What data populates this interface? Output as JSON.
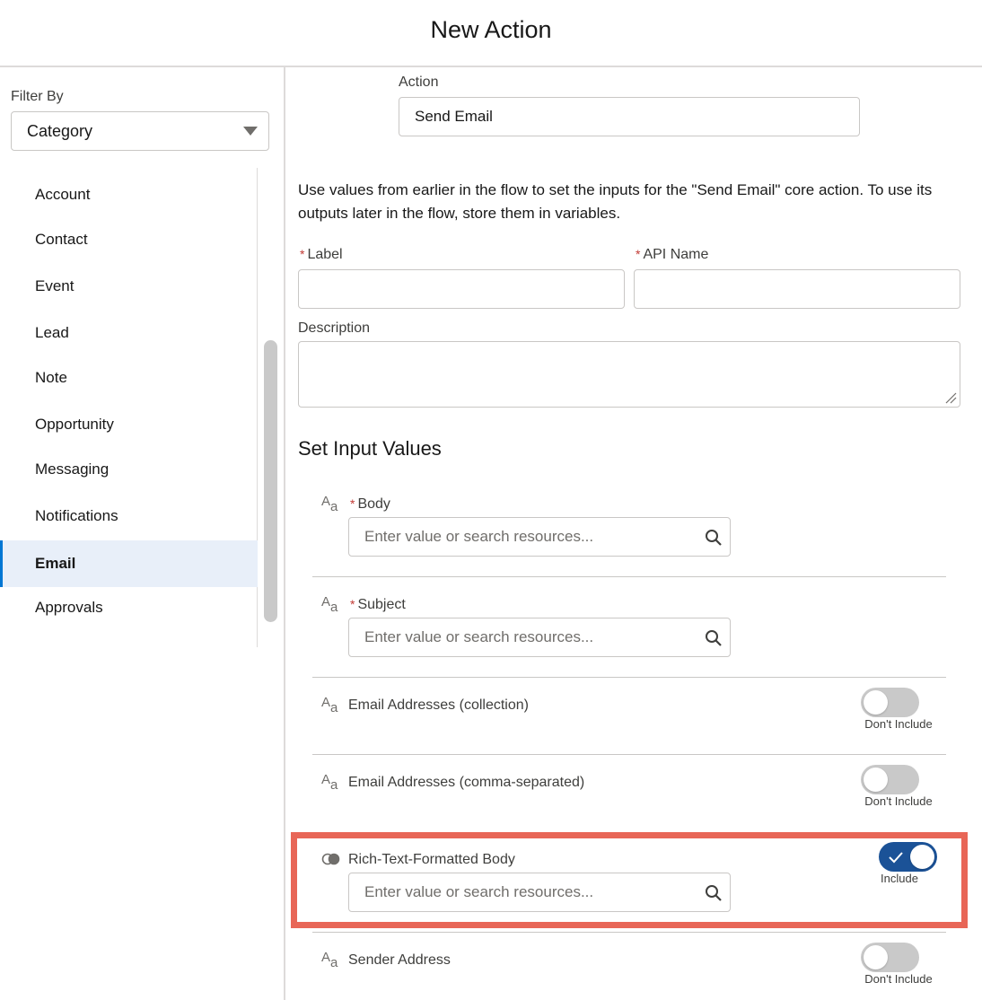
{
  "header": {
    "title": "New Action"
  },
  "sidebar": {
    "filter_label": "Filter By",
    "filter_value": "Category",
    "items": [
      {
        "label": "Account",
        "active": false
      },
      {
        "label": "Contact",
        "active": false
      },
      {
        "label": "Event",
        "active": false
      },
      {
        "label": "Lead",
        "active": false
      },
      {
        "label": "Note",
        "active": false
      },
      {
        "label": "Opportunity",
        "active": false
      },
      {
        "label": "Messaging",
        "active": false
      },
      {
        "label": "Notifications",
        "active": false
      },
      {
        "label": "Email",
        "active": true
      },
      {
        "label": "Approvals",
        "active": false
      }
    ]
  },
  "main": {
    "action_label": "Action",
    "action_value": "Send Email",
    "description_text": "Use values from earlier in the flow to set the inputs for the \"Send Email\" core action. To use its outputs later in the flow, store them in variables.",
    "label_field": {
      "label": "Label",
      "required_marker": "*",
      "value": ""
    },
    "api_name_field": {
      "label": "API Name",
      "required_marker": "*",
      "value": ""
    },
    "description_field": {
      "label": "Description",
      "value": ""
    },
    "section_title": "Set Input Values",
    "inputs": {
      "body": {
        "label": "Body",
        "required_marker": "*",
        "placeholder": "Enter value or search resources...",
        "type_icon": "text-type-icon"
      },
      "subject": {
        "label": "Subject",
        "required_marker": "*",
        "placeholder": "Enter value or search resources...",
        "type_icon": "text-type-icon"
      },
      "email_collection": {
        "label": "Email Addresses (collection)",
        "toggle_text": "Don't Include",
        "toggle_on": false,
        "type_icon": "text-type-icon"
      },
      "email_comma": {
        "label": "Email Addresses (comma-separated)",
        "toggle_text": "Don't Include",
        "toggle_on": false,
        "type_icon": "text-type-icon"
      },
      "rich_text": {
        "label": "Rich-Text-Formatted Body",
        "toggle_text": "Include",
        "toggle_on": true,
        "placeholder": "Enter value or search resources...",
        "type_icon": "boolean-type-icon"
      },
      "sender": {
        "label": "Sender Address",
        "toggle_text": "Don't Include",
        "toggle_on": false,
        "type_icon": "text-type-icon"
      }
    },
    "type_icon_glyphs": {
      "big": "A",
      "small": "a"
    }
  },
  "colors": {
    "highlight": "#e86657",
    "active_item_bg": "#e8eff9",
    "toggle_on": "#1b5297",
    "toggle_off": "#c9c9c9",
    "required": "#c23934"
  }
}
